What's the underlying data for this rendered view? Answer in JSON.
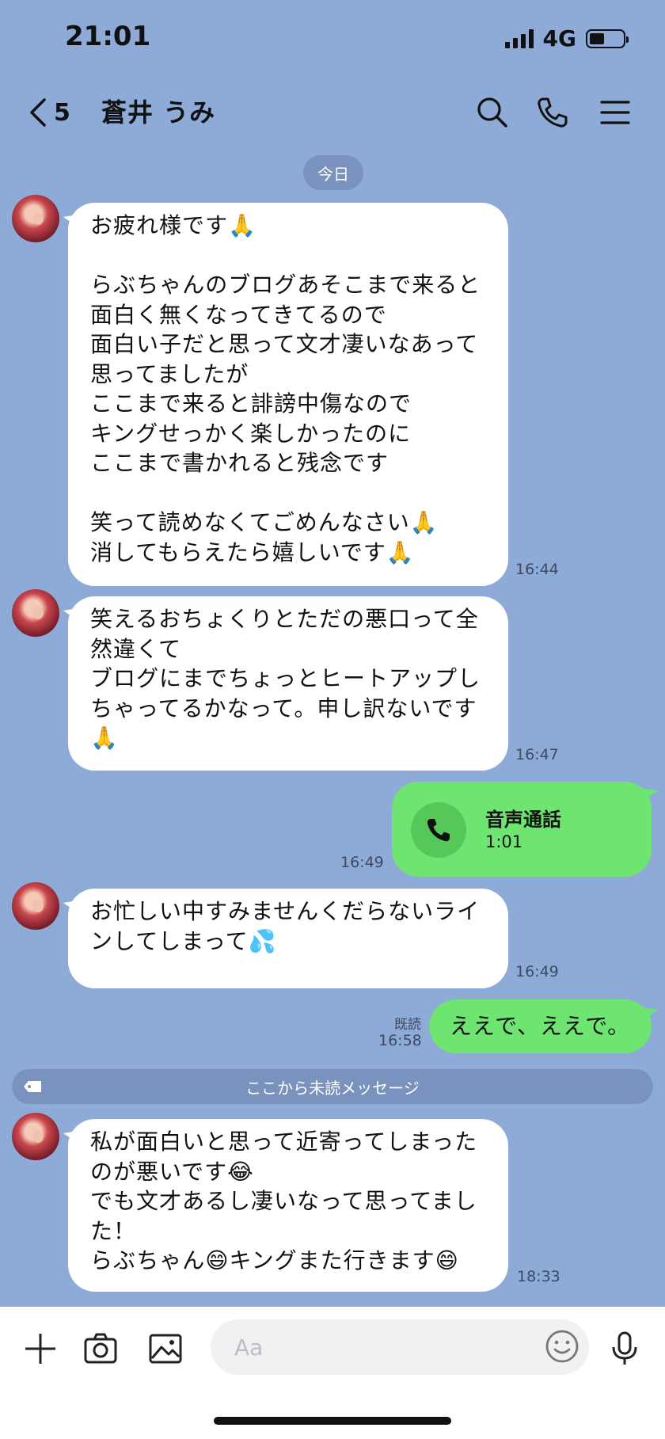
{
  "status": {
    "time": "21:01",
    "network": "4G",
    "battery_level": 0.45
  },
  "header": {
    "unread": "5",
    "title": "蒼井 うみ"
  },
  "date_label": "今日",
  "messages": [
    {
      "text": "お疲れ様です🙏\n\nらぶちゃんのブログあそこまで来ると\n面白く無くなってきてるので\n面白い子だと思って文才凄いなあって\n思ってましたが\nここまで来ると誹謗中傷なので\nキングせっかく楽しかったのに\nここまで書かれると残念です\n\n笑って読めなくてごめんなさい🙏\n消してもらえたら嬉しいです🙏",
      "time": "16:44"
    },
    {
      "text": "笑えるおちょくりとただの悪口って全\n然違くて\nブログにまでちょっとヒートアップし\nちゃってるかなって。申し訳ないです\n🙏",
      "time": "16:47"
    },
    {
      "text": "お忙しい中すみませんくだらないライ\nンしてしまって💦",
      "time": "16:49"
    },
    {
      "text": "私が面白いと思って近寄ってしまった\nのが悪いです😂\nでも文才あるし凄いなって思ってまし\nた！\nらぶちゃん😄キングまた行きます😄",
      "time": "18:33"
    }
  ],
  "call": {
    "title": "音声通話",
    "duration": "1:01",
    "time": "16:49"
  },
  "sent": {
    "text": "ええで、ええで。",
    "read": "既読",
    "time": "16:58"
  },
  "unread_divider": "ここから未読メッセージ",
  "input": {
    "placeholder": "Aa"
  }
}
